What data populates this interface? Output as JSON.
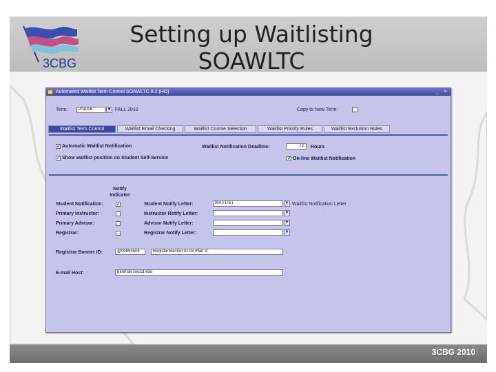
{
  "slide": {
    "title_line1": "Setting up Waitlisting",
    "title_line2": "SOAWLTC",
    "logo_text": "3CBG",
    "footer": "3CBG 2010"
  },
  "window": {
    "title": "Automated Waitlist Term Control SOAWLTC 8.2 (HO)",
    "minimize": "_",
    "close": "×",
    "term_label": "Term:",
    "term_value": "201008",
    "term_desc": "FALL 2010",
    "copy_label": "Copy to New Term:",
    "tabs": [
      {
        "label": "Waitlist Term Control",
        "active": true
      },
      {
        "label": "Waitlist Email Checking",
        "active": false
      },
      {
        "label": "Waitlist Course Selection",
        "active": false
      },
      {
        "label": "Waitlist Priority Rules",
        "active": false
      },
      {
        "label": "Waitlist Exclusion Rules",
        "active": false
      }
    ],
    "auto_notify_label": "Automatic Waitlist Notification",
    "show_position_label": "Show waitlist position on Student Self-Service",
    "deadline_label": "Waitlist Notification Deadline:",
    "deadline_value": "72",
    "hours_label": "Hours",
    "online_label": "On-line Waitlist Notification",
    "notify_header": "Notify Indicator",
    "rows": [
      {
        "label": "Student Notification:",
        "letter_label": "Student Notify Letter:",
        "letter_value": "WAITLIST",
        "letter_desc": "Waitlist Notification Letter",
        "checked": true
      },
      {
        "label": "Primary Instructor:",
        "letter_label": "Instructor Notify Letter:",
        "letter_value": "",
        "letter_desc": "",
        "checked": false
      },
      {
        "label": "Primary Advisor:",
        "letter_label": "Advisor Notify Letter:",
        "letter_value": "",
        "letter_desc": "",
        "checked": false
      },
      {
        "label": "Registrar:",
        "letter_label": "Registrar Notify Letter:",
        "letter_value": "",
        "letter_desc": "",
        "checked": false
      }
    ],
    "registrar_id_label": "Registrar Banner ID:",
    "registrar_id_value": "@00894504",
    "registrar_id_desc": "Registar Banner ID for Wait st",
    "email_host_label": "E-mail Host:",
    "email_host_value": "banmail.swccd.edu"
  }
}
